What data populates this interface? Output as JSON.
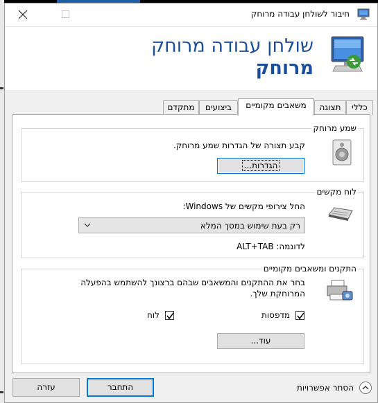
{
  "window": {
    "title": "חיבור לשולחן עבודה מרוחק",
    "close_glyph": "✕"
  },
  "header": {
    "line1": "שולחן עבודה מרוחק",
    "line2": "מרוחק"
  },
  "tabs": [
    {
      "label": "כללי",
      "active": false
    },
    {
      "label": "תצוגה",
      "active": false
    },
    {
      "label": "משאבים מקומיים",
      "active": true
    },
    {
      "label": "ביצועים",
      "active": false
    },
    {
      "label": "מתקדם",
      "active": false
    }
  ],
  "audio": {
    "legend": "שמע מרוחק",
    "description": "קבע תצורה של הגדרות שמע מרוחק.",
    "settings_button": "הגדרות..."
  },
  "keyboard": {
    "legend": "לוח מקשים",
    "description": "החל צירופי מקשים של Windows:",
    "selected_option": "רק בעת שימוש במסך המלא",
    "example": "לדוגמה: ALT+TAB"
  },
  "devices": {
    "legend": "התקנים ומשאבים מקומיים",
    "description_line1": "בחר את ההתקנים והמשאבים שבהם ברצונך להשתמש בהפעלה",
    "description_line2": "המרוחקת שלך.",
    "printers_label": "מדפסות",
    "printers_checked": true,
    "clipboard_label": "לוח",
    "clipboard_checked": true,
    "more_button": "עוד..."
  },
  "footer": {
    "hide_options": "הסתר אפשרויות",
    "connect_button": "התחבר",
    "help_button": "עזרה"
  },
  "colors": {
    "accent": "#0078d7",
    "header_text": "#1b4f9c"
  },
  "icons": {
    "app": "remote-desktop-icon",
    "audio": "speaker-icon",
    "keyboard": "keyboard-icon",
    "devices": "printer-device-icon",
    "collapse": "chevron-up-circle-icon"
  }
}
